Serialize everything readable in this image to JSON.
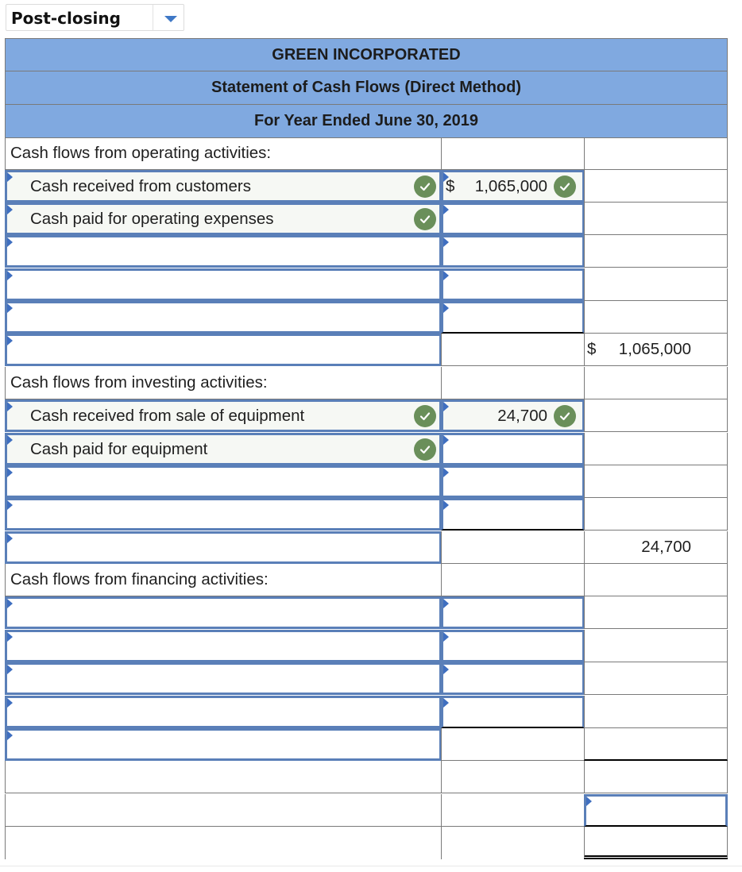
{
  "dropdown": {
    "selected": "Post-closing",
    "icon": "chevron-down-icon"
  },
  "header": {
    "company": "GREEN INCORPORATED",
    "statement": "Statement of Cash Flows (Direct Method)",
    "period": "For Year Ended June 30, 2019"
  },
  "colors": {
    "header_bg": "#80a9e0",
    "input_border": "#5a7fb8",
    "check_green": "#6a8f5a"
  },
  "operating": {
    "title": "Cash flows from operating activities:",
    "lines": [
      {
        "label": "Cash received from customers",
        "label_status": "correct",
        "amount_symbol": "$",
        "amount": "1,065,000",
        "amount_status": "correct"
      },
      {
        "label": "Cash paid for operating expenses",
        "label_status": "correct",
        "amount": ""
      },
      {
        "label": "",
        "amount": ""
      },
      {
        "label": "",
        "amount": ""
      },
      {
        "label": "",
        "amount": ""
      }
    ],
    "total_label": "",
    "total_symbol": "$",
    "total": "1,065,000"
  },
  "investing": {
    "title": "Cash flows from investing activities:",
    "lines": [
      {
        "label": "Cash received from sale of equipment",
        "label_status": "correct",
        "amount": "24,700",
        "amount_status": "correct"
      },
      {
        "label": "Cash paid for equipment",
        "label_status": "correct",
        "amount": ""
      },
      {
        "label": "",
        "amount": ""
      },
      {
        "label": "",
        "amount": ""
      }
    ],
    "total_label": "",
    "total": "24,700"
  },
  "financing": {
    "title": "Cash flows from financing activities:",
    "lines": [
      {
        "label": "",
        "amount": ""
      },
      {
        "label": "",
        "amount": ""
      },
      {
        "label": "",
        "amount": ""
      },
      {
        "label": "",
        "amount": ""
      }
    ],
    "total_label": "",
    "total": ""
  },
  "summary": {
    "net_change": "",
    "ending_balance": ""
  }
}
